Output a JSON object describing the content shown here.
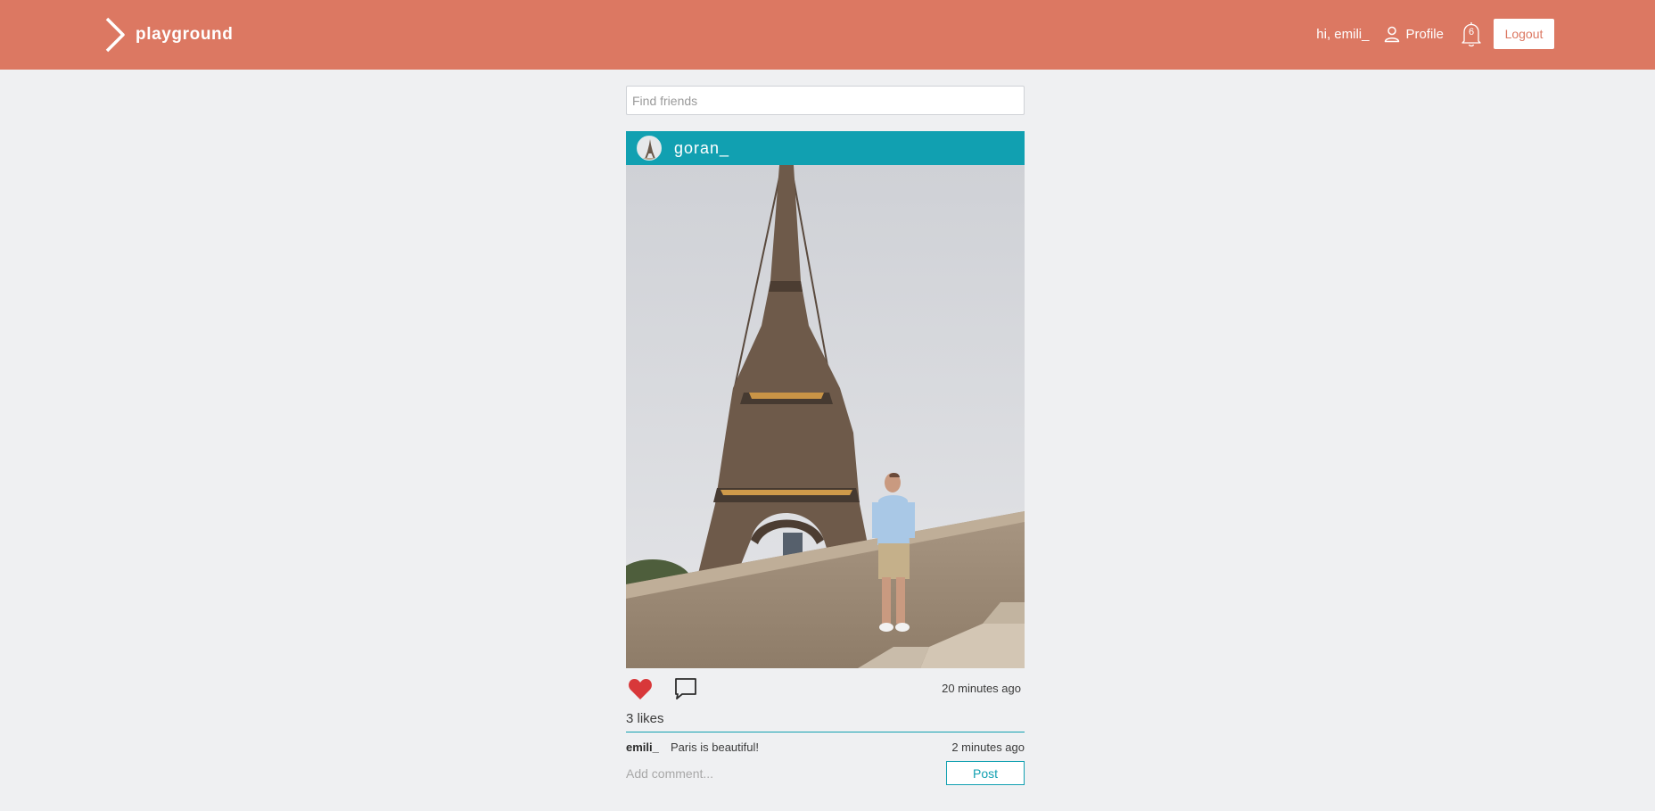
{
  "header": {
    "brand": "playground",
    "greeting": "hi, emili_",
    "profile_label": "Profile",
    "notification_count": "6",
    "logout_label": "Logout"
  },
  "search": {
    "placeholder": "Find friends"
  },
  "post": {
    "username": "goran_",
    "time": "20 minutes ago",
    "likes": "3 likes",
    "liked": true,
    "comments": [
      {
        "author": "emili_",
        "text": "Paris is beautiful!",
        "time": "2 minutes ago"
      }
    ],
    "add_comment_placeholder": "Add comment...",
    "post_label": "Post"
  },
  "colors": {
    "header": "#dc7862",
    "accent": "#11a0b1",
    "like": "#d8383a",
    "background": "#eff0f2"
  },
  "icons": [
    "chevron-right-icon",
    "user-icon",
    "bell-icon",
    "heart-icon",
    "comment-icon"
  ]
}
